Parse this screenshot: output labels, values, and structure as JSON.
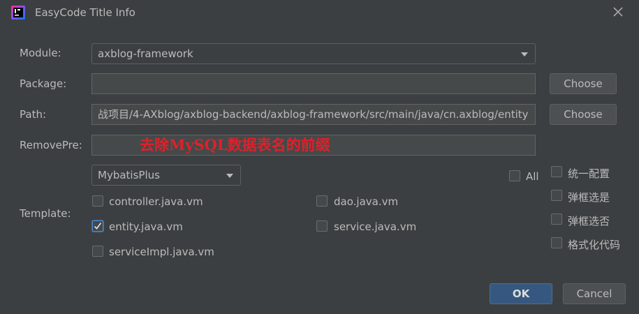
{
  "window": {
    "title": "EasyCode Title Info"
  },
  "form": {
    "module_label": "Module:",
    "module_value": "axblog-framework",
    "package_label": "Package:",
    "package_value": "",
    "path_label": "Path:",
    "path_value": "战项目/4-AXblog/axblog-backend/axblog-framework/src/main/java/cn.axblog/entity",
    "removepre_label": "RemovePre:",
    "removepre_value": "",
    "choose_label": "Choose",
    "annotation": "去除MySQL数据表名的前缀"
  },
  "template": {
    "label": "Template:",
    "group_value": "MybatisPlus",
    "all_label": "All",
    "items": [
      {
        "label": "controller.java.vm",
        "checked": false
      },
      {
        "label": "dao.java.vm",
        "checked": false
      },
      {
        "label": "entity.java.vm",
        "checked": true
      },
      {
        "label": "service.java.vm",
        "checked": false
      },
      {
        "label": "serviceImpl.java.vm",
        "checked": false
      }
    ]
  },
  "options": [
    {
      "label": "统一配置",
      "checked": false
    },
    {
      "label": "弹框选是",
      "checked": false
    },
    {
      "label": "弹框选否",
      "checked": false
    },
    {
      "label": "格式化代码",
      "checked": false
    }
  ],
  "buttons": {
    "ok": "OK",
    "cancel": "Cancel"
  },
  "colors": {
    "background": "#3c3f41",
    "accent": "#365880",
    "annotation": "#e0202a"
  }
}
